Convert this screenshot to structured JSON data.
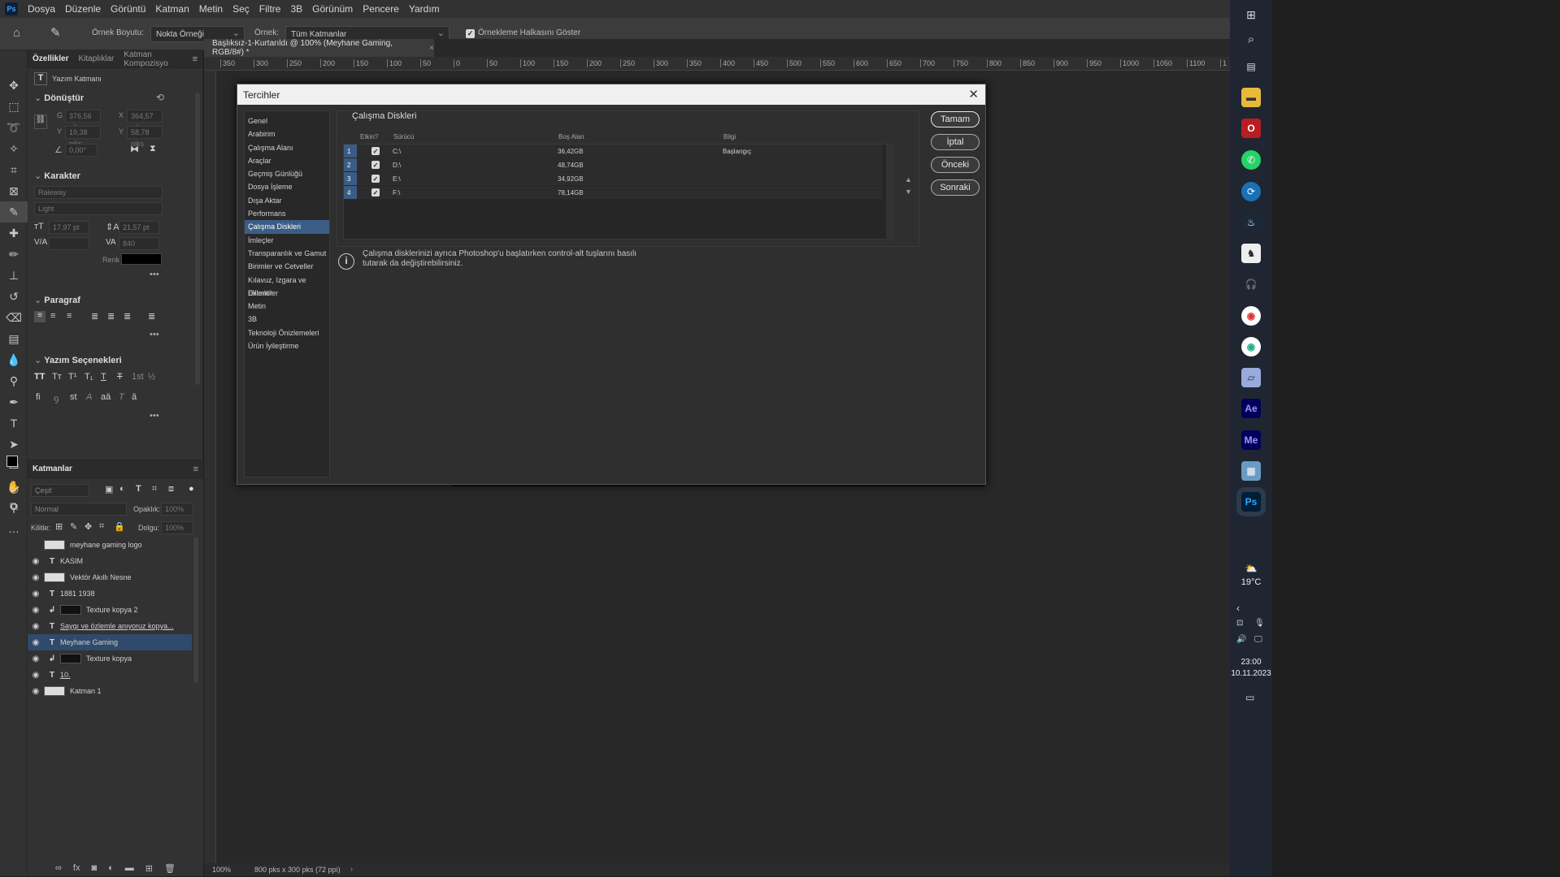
{
  "menubar": {
    "logo": "Ps",
    "items": [
      "Dosya",
      "Düzenle",
      "Görüntü",
      "Katman",
      "Metin",
      "Seç",
      "Filtre",
      "3B",
      "Görünüm",
      "Pencere",
      "Yardım"
    ]
  },
  "options": {
    "sample_size_label": "Örnek Boyutu:",
    "sample_size_value": "Nokta Örneği",
    "sample_label": "Örnek:",
    "sample_value": "Tüm Katmanlar",
    "show_ring_label": "Örnekleme Halkasını Göster"
  },
  "properties": {
    "tabs": [
      "Özellikler",
      "Kitaplıklar",
      "Katman Kompozisyo"
    ],
    "layer_kind": "Yazım Katmanı",
    "transform": {
      "title": "Dönüştür",
      "w_label": "G",
      "w": "376,56 piks",
      "x_label": "X",
      "x": "364,57 piks",
      "h_label": "Y",
      "h": "19,38 piks",
      "y_label": "Y",
      "y": "58,78 piks",
      "angle": "0,00°"
    },
    "character": {
      "title": "Karakter",
      "font": "Raleway",
      "style": "Light",
      "size": "17,97 pt",
      "leading": "21,57 pt",
      "tracking": "840",
      "color_label": "Renk",
      "color": "#000000"
    },
    "paragraph": {
      "title": "Paragraf"
    },
    "type_options": {
      "title": "Yazım Seçenekleri"
    }
  },
  "layers": {
    "title": "Katmanlar",
    "search_placeholder": "Çeşit",
    "blend_mode": "Normal",
    "opacity_label": "Opaklık:",
    "opacity": "100%",
    "lock_label": "Kilitle:",
    "fill_label": "Dolgu:",
    "fill": "100%",
    "items": [
      {
        "name": "meyhane gaming logo",
        "type": "smart",
        "visible": false
      },
      {
        "name": "KASIM",
        "type": "text",
        "visible": true
      },
      {
        "name": "Vektör Akıllı Nesne",
        "type": "smart",
        "visible": true
      },
      {
        "name": "1881    1938",
        "type": "text",
        "visible": true
      },
      {
        "name": "Texture kopya 2",
        "type": "pixel",
        "visible": true
      },
      {
        "name": "Saygı ve özlemle anıyoruz kopya...",
        "type": "text",
        "visible": true
      },
      {
        "name": "Meyhane Gaming",
        "type": "text",
        "visible": true,
        "selected": true
      },
      {
        "name": "Texture kopya",
        "type": "pixel",
        "visible": true
      },
      {
        "name": "10.",
        "type": "text",
        "visible": true
      },
      {
        "name": "Katman 1",
        "type": "pixel",
        "visible": true
      }
    ]
  },
  "document": {
    "tab_title": "Başlıksız-1-Kurtarıldı @ 100% (Meyhane Gaming, RGB/8#) *",
    "ruler_ticks": [
      "350",
      "300",
      "250",
      "200",
      "150",
      "100",
      "50",
      "0",
      "50",
      "100",
      "150",
      "200",
      "250",
      "300",
      "350",
      "400",
      "450",
      "500",
      "550",
      "600",
      "650",
      "700",
      "750",
      "800",
      "850",
      "900",
      "950",
      "1000",
      "1050",
      "1100",
      "1"
    ],
    "zoom": "100%",
    "doc_size": "800 pks x 300 pks (72 ppi)"
  },
  "dialog": {
    "title": "Tercihler",
    "nav": [
      "Genel",
      "Arabirim",
      "Çalışma Alanı",
      "Araçlar",
      "Geçmiş Günlüğü",
      "Dosya İşleme",
      "Dışa Aktar",
      "Performans",
      "Çalışma Diskleri",
      "İmleçler",
      "Transparanlık ve Gamut",
      "Birimler ve Cetveller",
      "Kılavuz, Izgara ve Dilimler",
      "Eklentiler",
      "Metin",
      "3B",
      "Teknoloji Önizlemeleri",
      "Ürün İyileştirme"
    ],
    "active_nav": "Çalışma Diskleri",
    "section_title": "Çalışma Diskleri",
    "columns": {
      "active": "Etkin?",
      "drive": "Sürücü",
      "free": "Boş Alan",
      "info": "Bilgi"
    },
    "rows": [
      {
        "num": "1",
        "drive": "C:\\",
        "free": "36,42GB",
        "info": "Başlangıç"
      },
      {
        "num": "2",
        "drive": "D:\\",
        "free": "48,74GB",
        "info": ""
      },
      {
        "num": "3",
        "drive": "E:\\",
        "free": "34,92GB",
        "info": ""
      },
      {
        "num": "4",
        "drive": "F:\\",
        "free": "78,14GB",
        "info": ""
      }
    ],
    "info_text": "Çalışma disklerinizi ayrıca Photoshop'u başlatırken control-alt tuşlarını basılı tutarak da değiştirebilirsiniz.",
    "buttons": {
      "ok": "Tamam",
      "cancel": "İptal",
      "prev": "Önceki",
      "next": "Sonraki"
    }
  },
  "taskbar": {
    "temperature": "19°C",
    "time": "23:00",
    "date": "10.11.2023",
    "icons": [
      "windows-start",
      "search",
      "task-view",
      "file-explorer",
      "opera",
      "whatsapp",
      "app-blue",
      "steam",
      "app-figure",
      "headset",
      "chrome-dev",
      "chrome",
      "notepad",
      "after-effects",
      "media-encoder",
      "calculator",
      "photoshop"
    ]
  }
}
